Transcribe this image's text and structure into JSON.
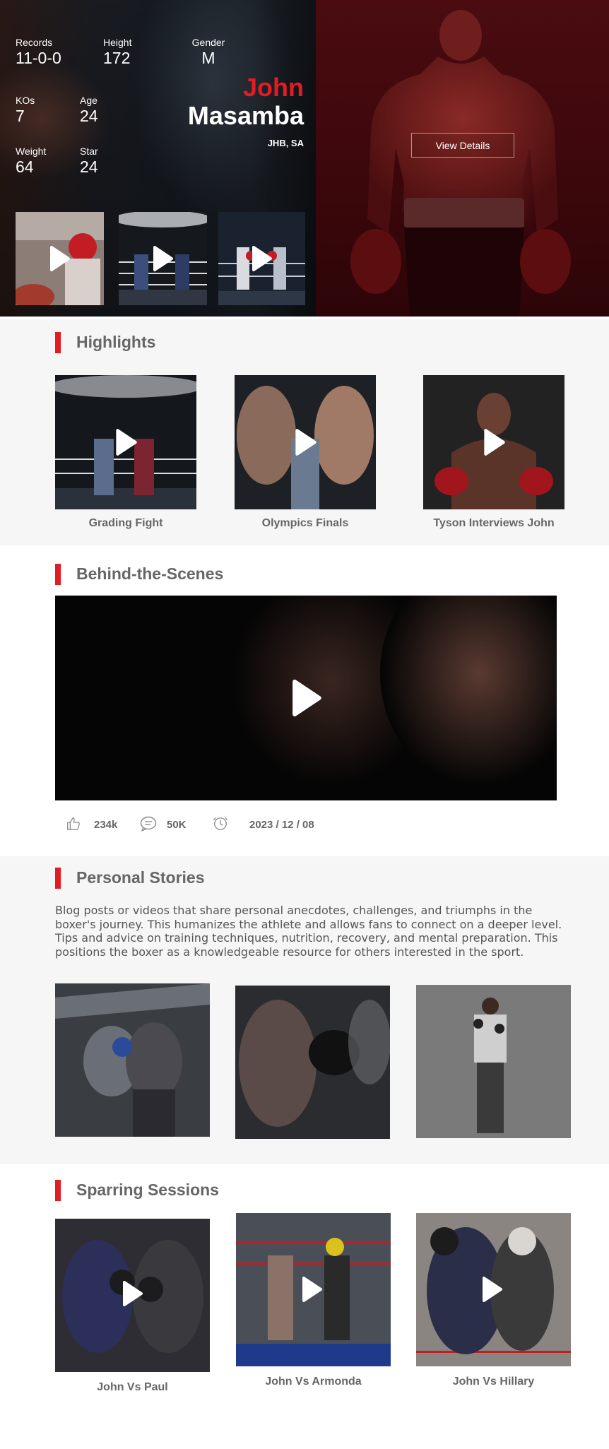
{
  "hero": {
    "stats": {
      "records": {
        "label": "Records",
        "value": "11-0-0"
      },
      "height": {
        "label": "Height",
        "value": "172"
      },
      "gender": {
        "label": "Gender",
        "value": "M"
      },
      "kos": {
        "label": "KOs",
        "value": "7"
      },
      "age": {
        "label": "Age",
        "value": "24"
      },
      "weight": {
        "label": "Weight",
        "value": "64"
      },
      "star": {
        "label": "Star",
        "value": "24"
      }
    },
    "first_name": "John",
    "last_name": "Masamba",
    "location": "JHB, SA",
    "view_details_label": "View Details",
    "colors": {
      "accent": "#e31b23",
      "overlay": "#3b070b"
    }
  },
  "highlights": {
    "title": "Highlights",
    "items": [
      {
        "caption": "Grading Fight",
        "icon": "play-icon"
      },
      {
        "caption": "Olympics Finals",
        "icon": "play-icon"
      },
      {
        "caption": "Tyson Interviews John",
        "icon": "play-icon"
      }
    ]
  },
  "behind_the_scenes": {
    "title": "Behind-the-Scenes",
    "likes": "234k",
    "comments": "50K",
    "date": "2023 / 12 / 08"
  },
  "personal_stories": {
    "title": "Personal Stories",
    "text": "Blog posts or videos that share personal anecdotes, challenges, and triumphs in the boxer's journey. This humanizes the athlete and allows fans to connect on a deeper level. Tips and advice on training techniques, nutrition, recovery, and mental preparation. This positions the boxer as a knowledgeable resource for others interested in the sport."
  },
  "sparring": {
    "title": "Sparring Sessions",
    "items": [
      {
        "caption": "John Vs Paul",
        "icon": "play-icon"
      },
      {
        "caption": "John Vs Armonda",
        "icon": "play-icon"
      },
      {
        "caption": "John Vs Hillary",
        "icon": "play-icon"
      }
    ]
  }
}
